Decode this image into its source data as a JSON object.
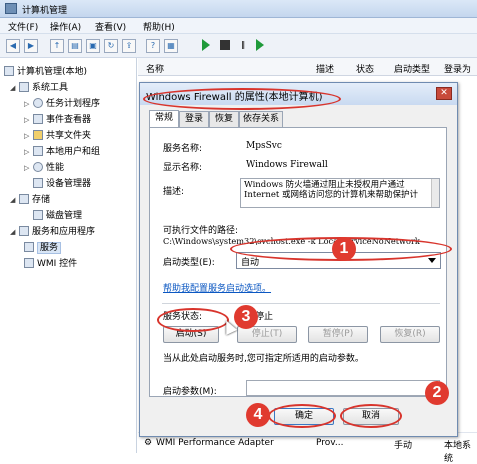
{
  "window": {
    "title": "计算机管理"
  },
  "menu": [
    "文件(F)",
    "操作(A)",
    "查看(V)",
    "帮助(H)"
  ],
  "tree": {
    "root": "计算机管理(本地)",
    "items": [
      {
        "label": "系统工具"
      },
      {
        "label": "任务计划程序"
      },
      {
        "label": "事件查看器"
      },
      {
        "label": "共享文件夹"
      },
      {
        "label": "本地用户和组"
      },
      {
        "label": "性能"
      },
      {
        "label": "设备管理器"
      },
      {
        "label": "存储"
      },
      {
        "label": "磁盘管理"
      },
      {
        "label": "服务和应用程序"
      },
      {
        "label": "服务"
      },
      {
        "label": "WMI 控件"
      }
    ]
  },
  "list": {
    "headers": [
      "名称",
      "描述",
      "状态",
      "启动类型",
      "登录为"
    ],
    "bottom_row": {
      "name": "WMI Performance Adapter",
      "desc": "Prov...",
      "type": "手动",
      "logon": "本地系统"
    }
  },
  "dialog": {
    "title": "Windows Firewall 的属性(本地计算机)",
    "tabs": [
      "常规",
      "登录",
      "恢复",
      "依存关系"
    ],
    "service_name_label": "服务名称:",
    "service_name": "MpsSvc",
    "display_name_label": "显示名称:",
    "display_name": "Windows Firewall",
    "desc_label": "描述:",
    "desc_line1": "Windows 防火墙通过阻止未授权用户通过",
    "desc_line2": "Internet 或网络访问您的计算机来帮助保护计",
    "path_label": "可执行文件的路径:",
    "path": "C:\\Windows\\system32\\svchost.exe -k LocalServiceNoNetwork",
    "startup_type_label": "启动类型(E):",
    "startup_type": "自动",
    "help_link": "帮助我配置服务启动选项。",
    "status_label": "服务状态:",
    "status": "已停止",
    "btn_start": "启动(S)",
    "btn_stop": "停止(T)",
    "btn_pause": "暂停(P)",
    "btn_resume": "恢复(R)",
    "hint": "当从此处启动服务时,您可指定所适用的启动参数。",
    "params_label": "启动参数(M):",
    "btn_ok": "确定",
    "btn_cancel": "取消"
  },
  "annotations": [
    "1",
    "2",
    "3",
    "4"
  ]
}
